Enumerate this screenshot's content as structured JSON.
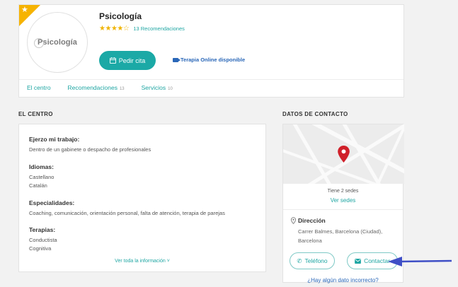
{
  "profile": {
    "title": "Psicología",
    "logo_text": "Psicología",
    "rating_stars": 4,
    "rating_max": 5,
    "recommendations_text": "13 Recomendaciones",
    "cta_label": "Pedir cita",
    "online_label": "Terapia Online disponible",
    "tabs": [
      {
        "label": "El centro",
        "count": ""
      },
      {
        "label": "Recomendaciones",
        "count": "13"
      },
      {
        "label": "Servicios",
        "count": "10"
      }
    ]
  },
  "centro": {
    "section_title": "EL CENTRO",
    "blocks": [
      {
        "heading": "Ejerzo mi trabajo:",
        "lines": [
          "Dentro de un gabinete o despacho de profesionales"
        ]
      },
      {
        "heading": "Idiomas:",
        "lines": [
          "Castellano",
          "Catalán"
        ]
      },
      {
        "heading": "Especialidades:",
        "lines": [
          "Coaching, comunicación, orientación personal, falta de atención, terapia de parejas"
        ]
      },
      {
        "heading": "Terapias:",
        "lines": [
          "Conductista",
          "Cognitiva"
        ]
      }
    ],
    "more_label": "Ver toda la información ˅"
  },
  "contact": {
    "section_title": "DATOS DE CONTACTO",
    "sedes_text": "Tiene 2 sedes",
    "ver_sedes": "Ver sedes",
    "direccion_label": "Dirección",
    "address_lines": [
      "Carrer Balmes, Barcelona (Ciudad),",
      "Barcelona"
    ],
    "phone_button": "Teléfono",
    "contact_button": "Contactar",
    "incorrect_link": "¿Hay algún dato incorrecto?"
  },
  "colors": {
    "accent": "#1ba9a6",
    "link_blue": "#2a67b8",
    "star": "#f0b400",
    "ribbon": "#f6b300",
    "arrow": "#3f4fc6",
    "pin": "#d0202a"
  }
}
